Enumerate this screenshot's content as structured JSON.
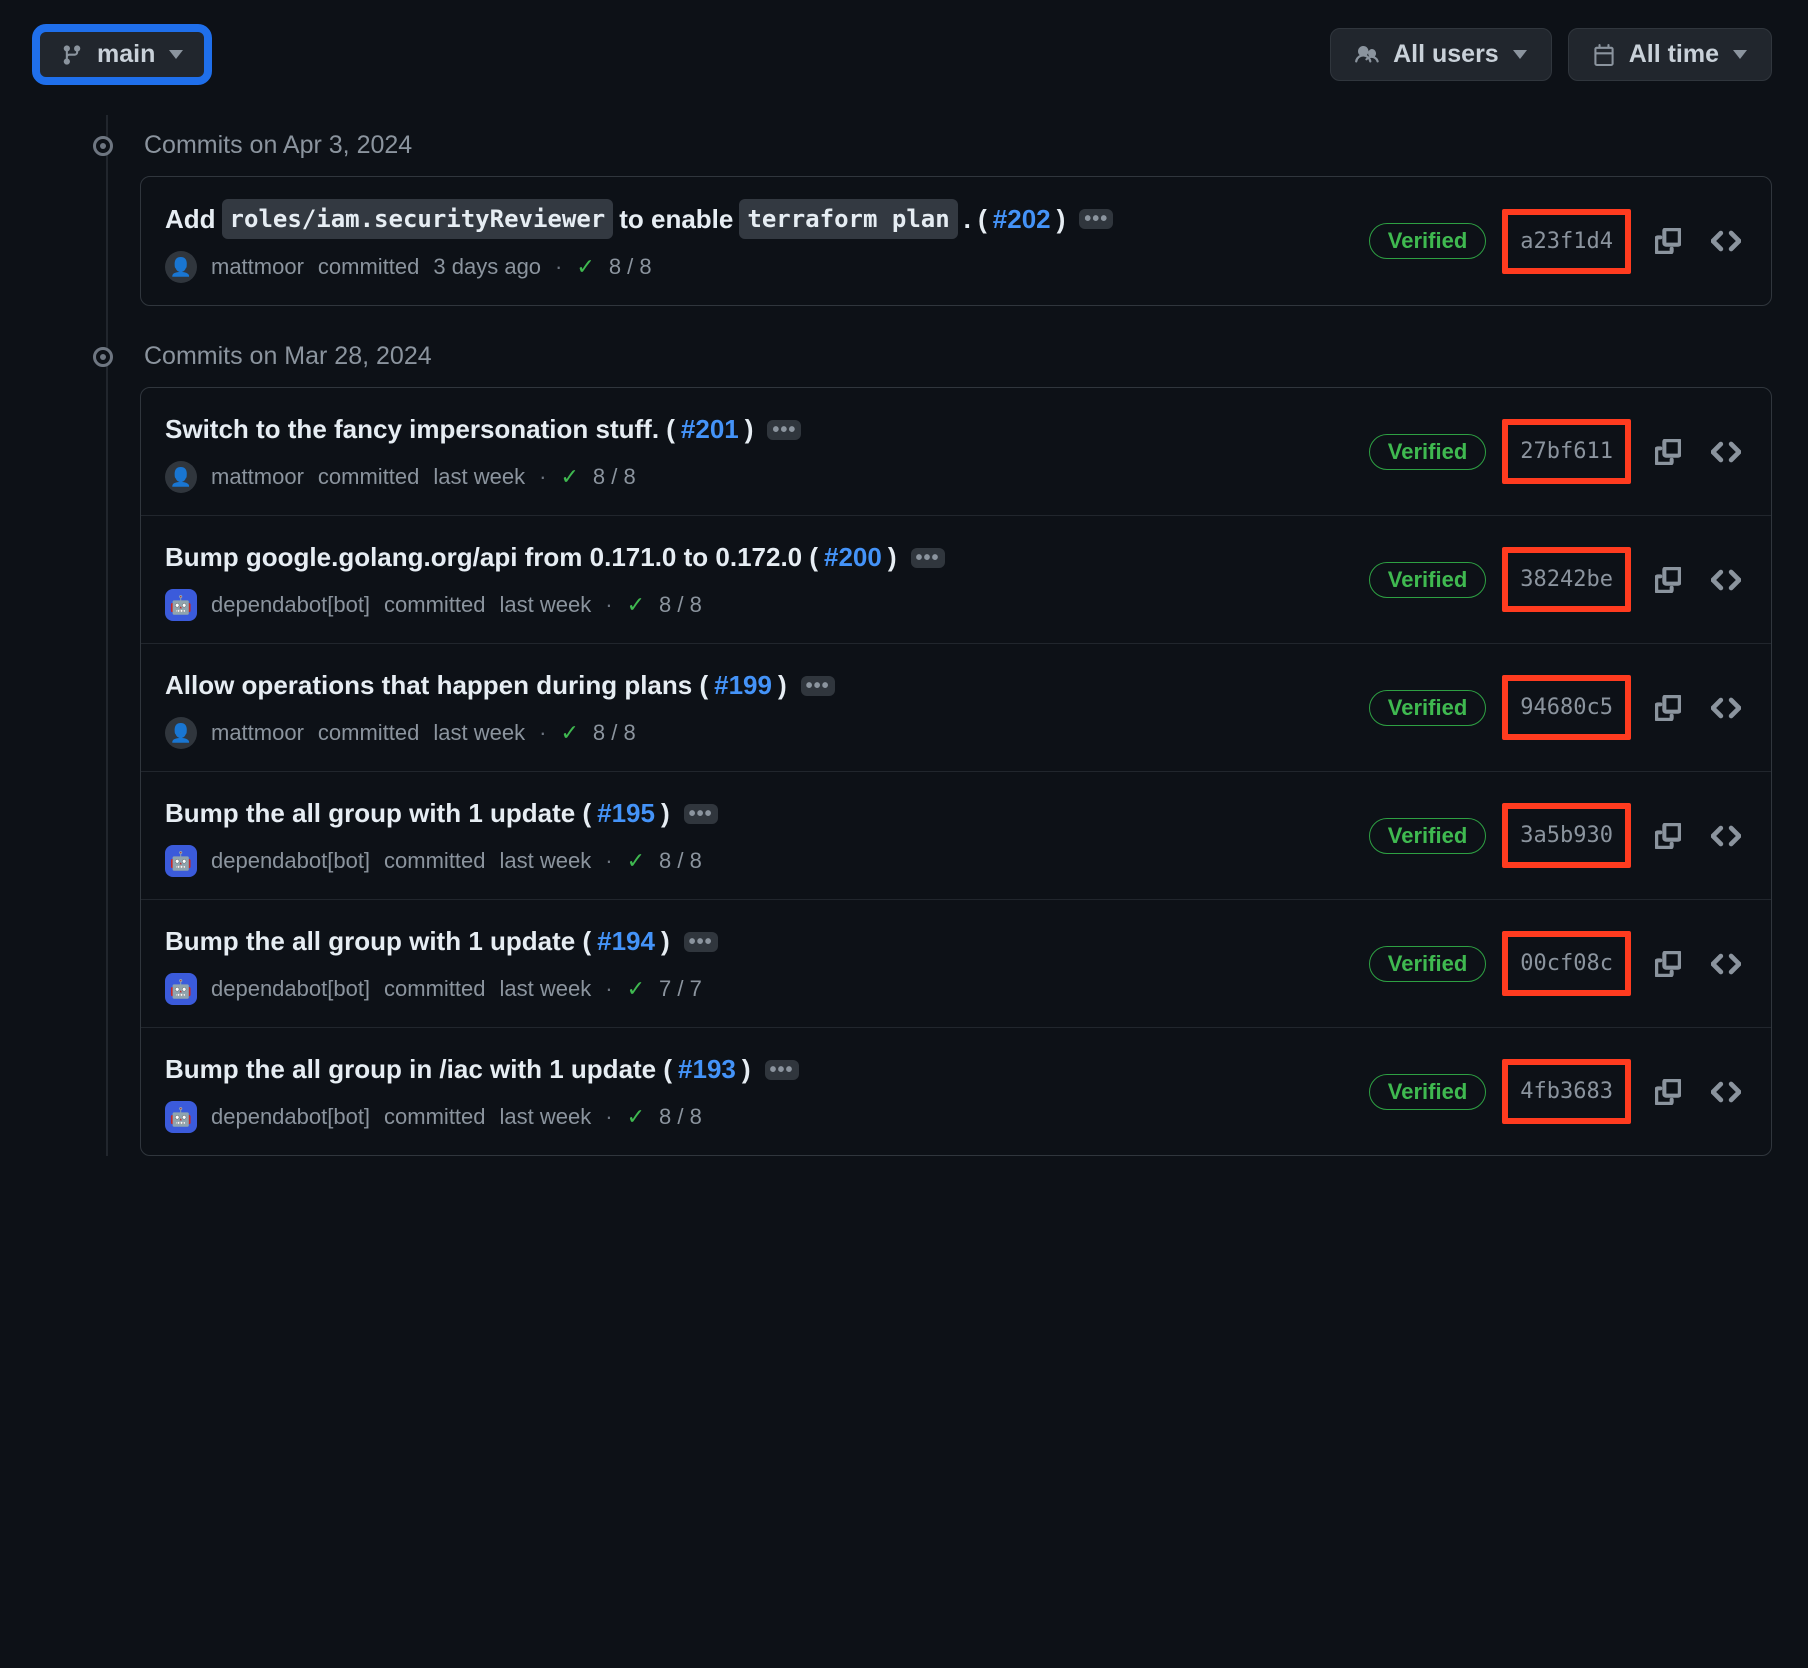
{
  "toolbar": {
    "branch_label": "main",
    "users_label": "All users",
    "time_label": "All time"
  },
  "groups": [
    {
      "heading": "Commits on Apr 3, 2024",
      "commits": [
        {
          "title_prefix": "Add ",
          "code1": "roles/iam.securityReviewer",
          "title_mid": " to enable ",
          "code2": "terraform plan",
          "title_suffix": ". (",
          "pr": "#202",
          "title_close": ")",
          "author": "mattmoor",
          "author_type": "user",
          "when": "3 days ago",
          "checks": "8 / 8",
          "verified": "Verified",
          "sha": "a23f1d4"
        }
      ]
    },
    {
      "heading": "Commits on Mar 28, 2024",
      "commits": [
        {
          "title_prefix": "Switch to the fancy impersonation stuff. (",
          "pr": "#201",
          "title_close": ")",
          "author": "mattmoor",
          "author_type": "user",
          "when": "last week",
          "checks": "8 / 8",
          "verified": "Verified",
          "sha": "27bf611"
        },
        {
          "title_prefix": "Bump google.golang.org/api from 0.171.0 to 0.172.0 (",
          "pr": "#200",
          "title_close": ")",
          "author": "dependabot[bot]",
          "author_type": "bot",
          "when": "last week",
          "checks": "8 / 8",
          "verified": "Verified",
          "sha": "38242be"
        },
        {
          "title_prefix": "Allow operations that happen during plans (",
          "pr": "#199",
          "title_close": ")",
          "author": "mattmoor",
          "author_type": "user",
          "when": "last week",
          "checks": "8 / 8",
          "verified": "Verified",
          "sha": "94680c5"
        },
        {
          "title_prefix": "Bump the all group with 1 update (",
          "pr": "#195",
          "title_close": ")",
          "author": "dependabot[bot]",
          "author_type": "bot",
          "when": "last week",
          "checks": "8 / 8",
          "verified": "Verified",
          "sha": "3a5b930"
        },
        {
          "title_prefix": "Bump the all group with 1 update (",
          "pr": "#194",
          "title_close": ")",
          "author": "dependabot[bot]",
          "author_type": "bot",
          "when": "last week",
          "checks": "7 / 7",
          "verified": "Verified",
          "sha": "00cf08c"
        },
        {
          "title_prefix": "Bump the all group in /iac with 1 update (",
          "pr": "#193",
          "title_close": ")",
          "author": "dependabot[bot]",
          "author_type": "bot",
          "when": "last week",
          "checks": "8 / 8",
          "verified": "Verified",
          "sha": "4fb3683"
        }
      ]
    }
  ]
}
